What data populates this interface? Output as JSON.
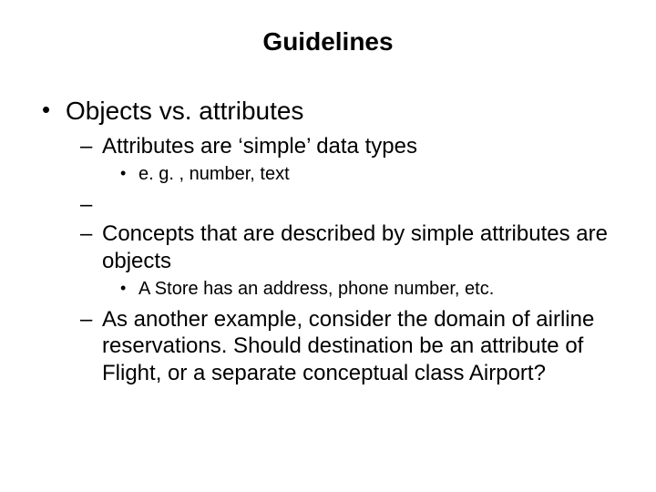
{
  "title": "Guidelines",
  "bullets": {
    "l1_0": "Objects vs. attributes",
    "l2_0": "Attributes are ‘simple’ data types",
    "l3_0": "e. g. , number, text",
    "l2_1": "Concepts that are described by simple attributes are objects",
    "l3_1": "A Store has an address, phone number, etc.",
    "l2_2": "As another example, consider the domain of airline reservations. Should destination be an attribute of Flight, or a separate conceptual class Airport?"
  }
}
